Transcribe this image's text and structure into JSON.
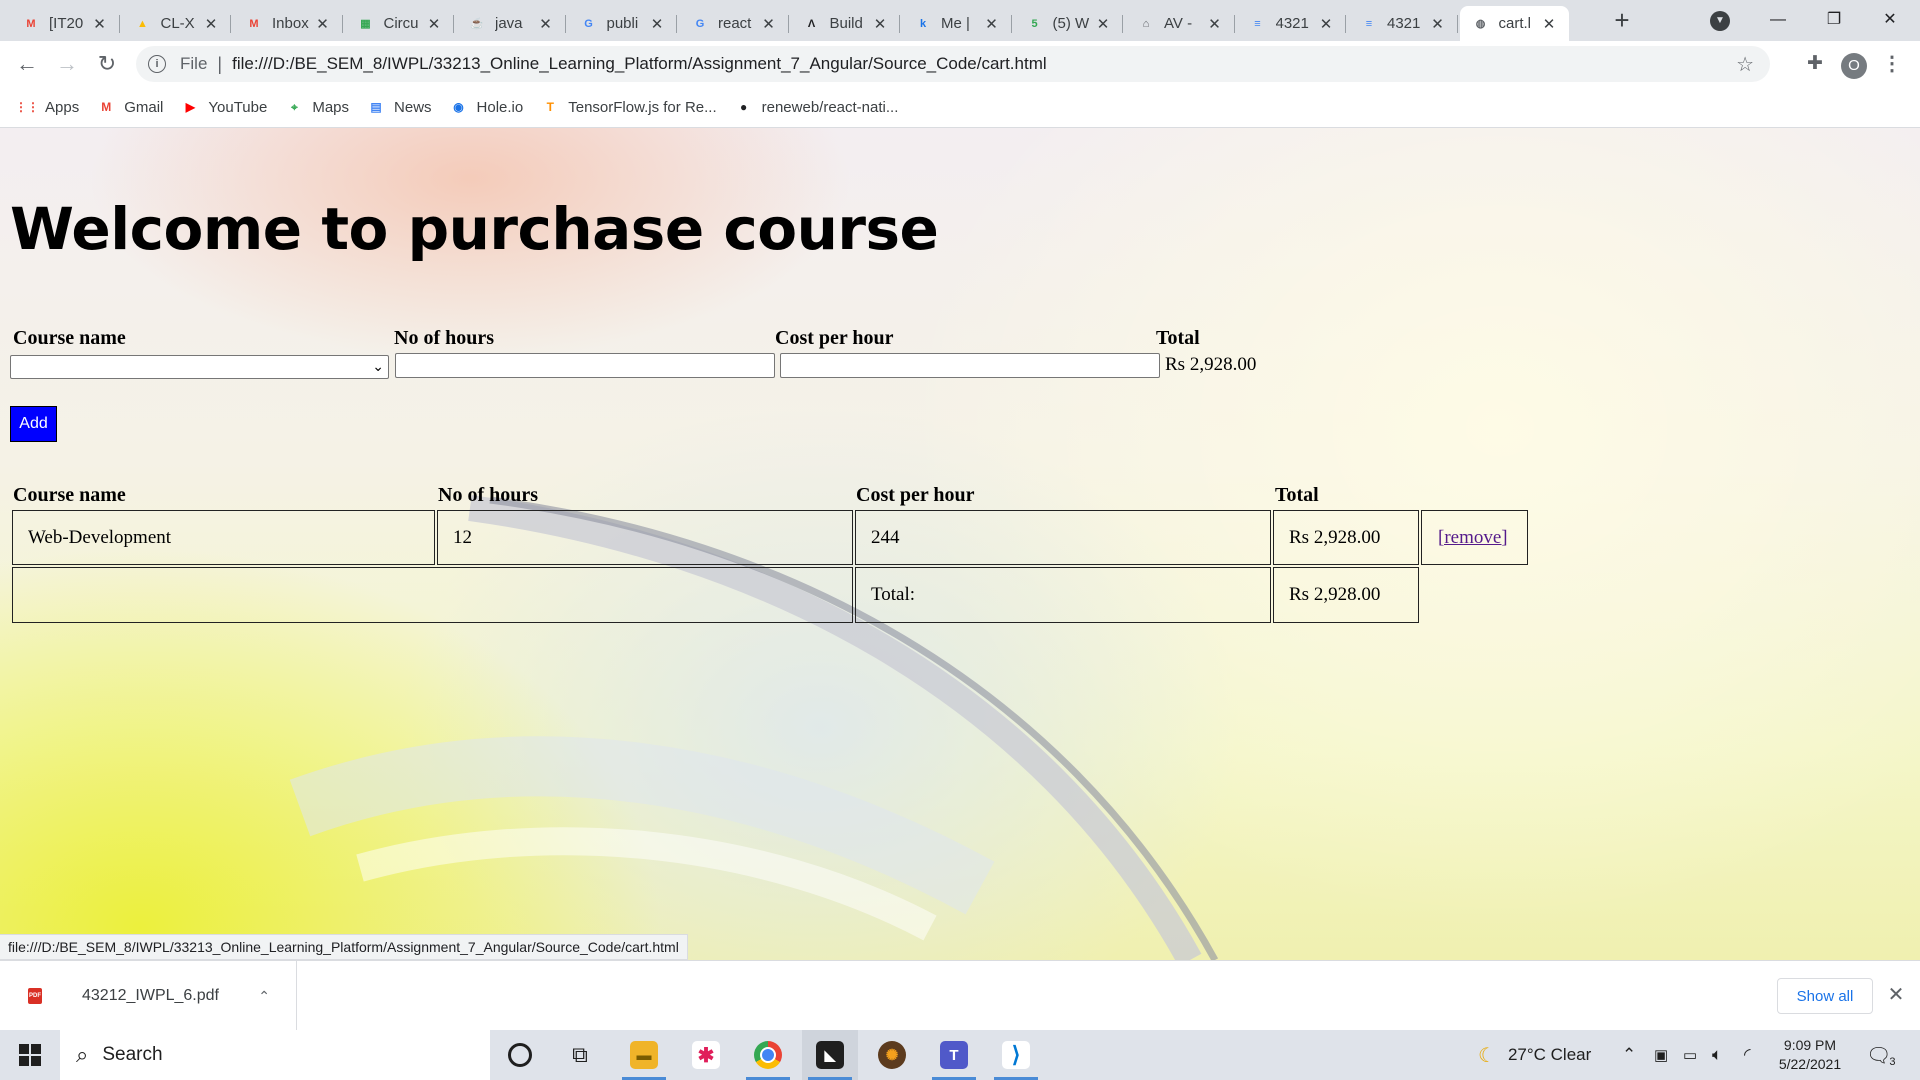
{
  "browser": {
    "tabs": [
      {
        "title": "[IT20",
        "icon": "gmail-icon",
        "color": "#ea4335",
        "glyph": "M"
      },
      {
        "title": "CL-X",
        "icon": "drive-icon",
        "color": "#fbbc04",
        "glyph": "▲"
      },
      {
        "title": "Inbox",
        "icon": "gmail-icon",
        "color": "#ea4335",
        "glyph": "M"
      },
      {
        "title": "Circu",
        "icon": "circuit-icon",
        "color": "#34a853",
        "glyph": "▦"
      },
      {
        "title": "java",
        "icon": "java-icon",
        "color": "#e76f00",
        "glyph": "☕"
      },
      {
        "title": "publi",
        "icon": "google-icon",
        "color": "#4285f4",
        "glyph": "G"
      },
      {
        "title": "react",
        "icon": "google-icon",
        "color": "#4285f4",
        "glyph": "G"
      },
      {
        "title": "Build",
        "icon": "build-icon",
        "color": "#202124",
        "glyph": "Λ"
      },
      {
        "title": "Me |",
        "icon": "k-icon",
        "color": "#1a73e8",
        "glyph": "k"
      },
      {
        "title": "(5) W",
        "icon": "whatsapp-icon",
        "color": "#34a853",
        "glyph": "5"
      },
      {
        "title": "AV -",
        "icon": "av-icon",
        "color": "#5f6368",
        "glyph": "⌂"
      },
      {
        "title": "4321",
        "icon": "docs-icon",
        "color": "#4285f4",
        "glyph": "≡"
      },
      {
        "title": "4321",
        "icon": "docs-icon",
        "color": "#4285f4",
        "glyph": "≡"
      },
      {
        "title": "cart.l",
        "icon": "globe-icon",
        "color": "#5f6368",
        "glyph": "◍",
        "active": true
      }
    ],
    "url_scheme_label": "File",
    "url": "file:///D:/BE_SEM_8/IWPL/33213_Online_Learning_Platform/Assignment_7_Angular/Source_Code/cart.html",
    "profile_initial": "O",
    "bookmarks": [
      {
        "label": "Apps",
        "icon": "apps-icon",
        "color": "#ea4335",
        "glyph": "⋮⋮"
      },
      {
        "label": "Gmail",
        "icon": "gmail-icon",
        "color": "#ea4335",
        "glyph": "M"
      },
      {
        "label": "YouTube",
        "icon": "youtube-icon",
        "color": "#ff0000",
        "glyph": "▶"
      },
      {
        "label": "Maps",
        "icon": "maps-icon",
        "color": "#34a853",
        "glyph": "⌖"
      },
      {
        "label": "News",
        "icon": "news-icon",
        "color": "#4285f4",
        "glyph": "▤"
      },
      {
        "label": "Hole.io",
        "icon": "holeio-icon",
        "color": "#1a73e8",
        "glyph": "◉"
      },
      {
        "label": "TensorFlow.js for Re...",
        "icon": "tensorflow-icon",
        "color": "#ff8f00",
        "glyph": "T"
      },
      {
        "label": "reneweb/react-nati...",
        "icon": "github-icon",
        "color": "#202124",
        "glyph": "●"
      }
    ],
    "status_url": "file:///D:/BE_SEM_8/IWPL/33213_Online_Learning_Platform/Assignment_7_Angular/Source_Code/cart.html"
  },
  "page": {
    "heading": "Welcome to purchase course",
    "form": {
      "course_label": "Course name",
      "hours_label": "No of hours",
      "cost_label": "Cost per hour",
      "total_label": "Total",
      "course_value": "",
      "hours_value": "",
      "cost_value": "",
      "total_value": "Rs 2,928.00",
      "add_label": "Add"
    },
    "table": {
      "headers": [
        "Course name",
        "No of hours",
        "Cost per hour",
        "Total"
      ],
      "rows": [
        {
          "course": "Web-Development",
          "hours": "12",
          "cost": "244",
          "total": "Rs 2,928.00",
          "action": "[remove]"
        }
      ],
      "footer_label": "Total:",
      "footer_total": "Rs 2,928.00"
    }
  },
  "downloads": {
    "file": "43212_IWPL_6.pdf",
    "show_all": "Show all"
  },
  "taskbar": {
    "search_placeholder": "Search",
    "weather": "27°C  Clear",
    "time": "9:09 PM",
    "date": "5/22/2021",
    "notifications": "3"
  }
}
